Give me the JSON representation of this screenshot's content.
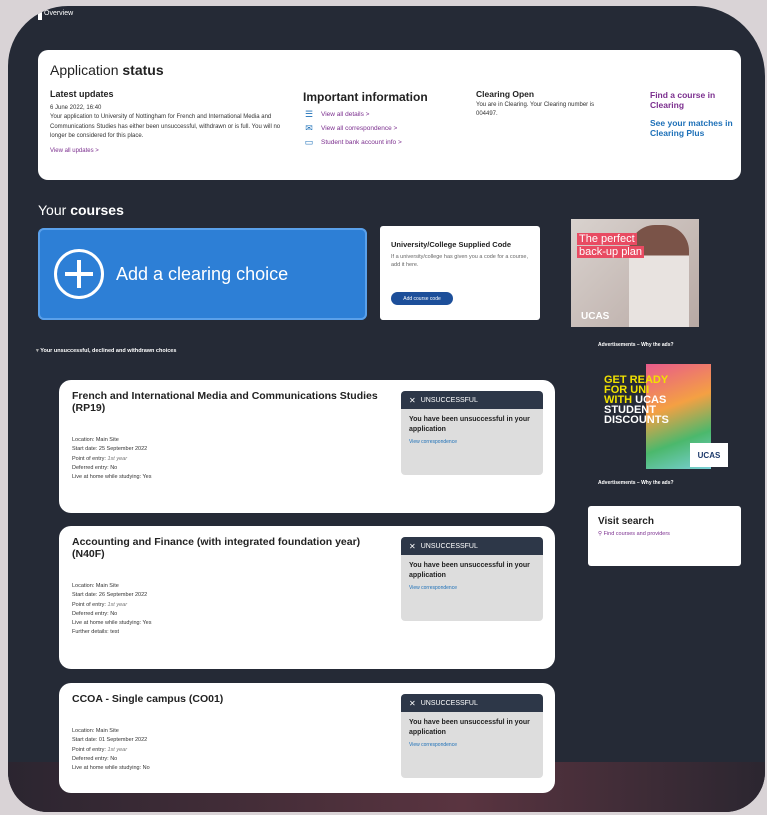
{
  "breadcrumb": "Overview",
  "status": {
    "title_plain": "Application ",
    "title_bold": "status",
    "latest_updates": {
      "heading": "Latest updates",
      "date": "6 June 2022, 16:40",
      "body": "Your application to University of Nottingham for French and International Media and Communications Studies has either been unsuccessful, withdrawn or is full. You will no longer be considered for this place.",
      "link": "View all updates >"
    },
    "important": {
      "heading": "Important information",
      "links": [
        {
          "icon": "list-icon",
          "label": "View all details >"
        },
        {
          "icon": "envelope-icon",
          "label": "View all correspondence >"
        },
        {
          "icon": "card-icon",
          "label": "Student bank account info >"
        }
      ]
    },
    "clearing": {
      "heading": "Clearing Open",
      "body": "You are in Clearing. Your Clearing number is 004497."
    },
    "find_course": "Find a course in Clearing",
    "see_matches": "See your matches in Clearing Plus"
  },
  "courses": {
    "title_plain": "Your ",
    "title_bold": "courses",
    "add_label": "Add a clearing choice",
    "code_card": {
      "heading": "University/College Supplied Code",
      "body": "If a university/college has given you a code for a course, add it here.",
      "button": "Add course code"
    },
    "ad1": {
      "line1": "The perfect",
      "line2": "back-up plan",
      "logo": "UCAS"
    },
    "ad_caption": "Advertisements – Why the ads?",
    "ad2": {
      "l1": "GET READY",
      "l2": "FOR UNI",
      "l3": "WITH UCAS",
      "l4": "STUDENT",
      "l5": "DISCOUNTS",
      "logo": "UCAS"
    },
    "unsuccessful_header": "Your unsuccessful, declined and withdrawn choices",
    "visit": {
      "heading": "Visit search",
      "link": "Find courses and providers"
    }
  },
  "choices": [
    {
      "title": "French and International Media and Communications Studies (RP19)",
      "location": "Location: Main Site",
      "start": "Start date: 25 September 2022",
      "entry_label": "Point of entry: ",
      "entry_value": "1st year",
      "deferred": "Deferred entry: No",
      "home": "Live at home while studying: Yes",
      "further": "",
      "status": "UNSUCCESSFUL",
      "message": "You have been unsuccessful in your application",
      "link": "View correspondence"
    },
    {
      "title": "Accounting and Finance (with integrated foundation year) (N40F)",
      "location": "Location: Main Site",
      "start": "Start date: 26 September 2022",
      "entry_label": "Point of entry: ",
      "entry_value": "1st year",
      "deferred": "Deferred entry: No",
      "home": "Live at home while studying: Yes",
      "further": "Further details: test",
      "status": "UNSUCCESSFUL",
      "message": "You have been unsuccessful in your application",
      "link": "View correspondence"
    },
    {
      "title": "CCOA - Single campus (CO01)",
      "location": "Location: Main Site",
      "start": "Start date: 01 September 2022",
      "entry_label": "Point of entry: ",
      "entry_value": "1st year",
      "deferred": "Deferred entry: No",
      "home": "Live at home while studying: No",
      "further": "",
      "status": "UNSUCCESSFUL",
      "message": "You have been unsuccessful in your application",
      "link": "View correspondence"
    }
  ]
}
